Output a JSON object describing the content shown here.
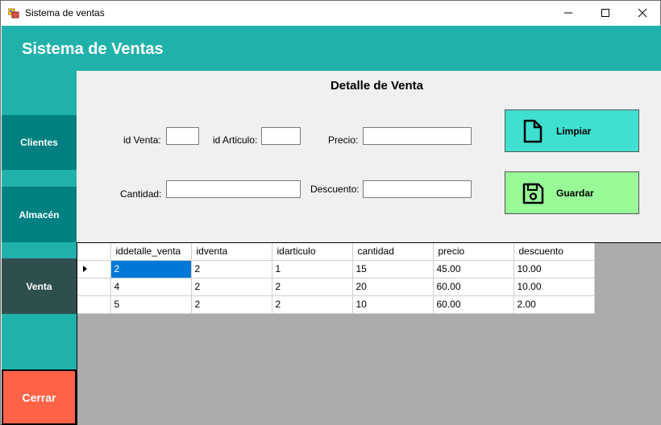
{
  "window": {
    "title": "Sistema de ventas"
  },
  "header": {
    "title": "Sistema de Ventas"
  },
  "sidebar": {
    "items": [
      {
        "label": "Clientes"
      },
      {
        "label": "Almacén"
      },
      {
        "label": "Venta"
      },
      {
        "label": "Cerrar"
      }
    ]
  },
  "form": {
    "title": "Detalle de Venta",
    "labels": {
      "id_venta": "id Venta:",
      "id_articulo": "id Articulo:",
      "precio": "Precio:",
      "cantidad": "Cantidad:",
      "descuento": "Descuento:"
    },
    "values": {
      "id_venta": "",
      "id_articulo": "",
      "precio": "",
      "cantidad": "",
      "descuento": ""
    },
    "buttons": {
      "limpiar": "Limpiar",
      "guardar": "Guardar"
    }
  },
  "grid": {
    "columns": [
      "iddetalle_venta",
      "idventa",
      "idarticulo",
      "cantidad",
      "precio",
      "descuento"
    ],
    "rows": [
      [
        "2",
        "2",
        "1",
        "15",
        "45.00",
        "10.00"
      ],
      [
        "4",
        "2",
        "2",
        "20",
        "60.00",
        "10.00"
      ],
      [
        "5",
        "2",
        "2",
        "10",
        "60.00",
        "2.00"
      ]
    ]
  },
  "colors": {
    "header": "#20b2aa",
    "nav": "#008080",
    "nav_active": "#2f4f4f",
    "close": "#ff6347",
    "limpiar": "#40e0d0",
    "guardar": "#98fb98",
    "selection": "#0078d7"
  },
  "icons": {
    "app": "app-icon",
    "limpiar": "document-icon",
    "guardar": "floppy-disk-icon"
  }
}
